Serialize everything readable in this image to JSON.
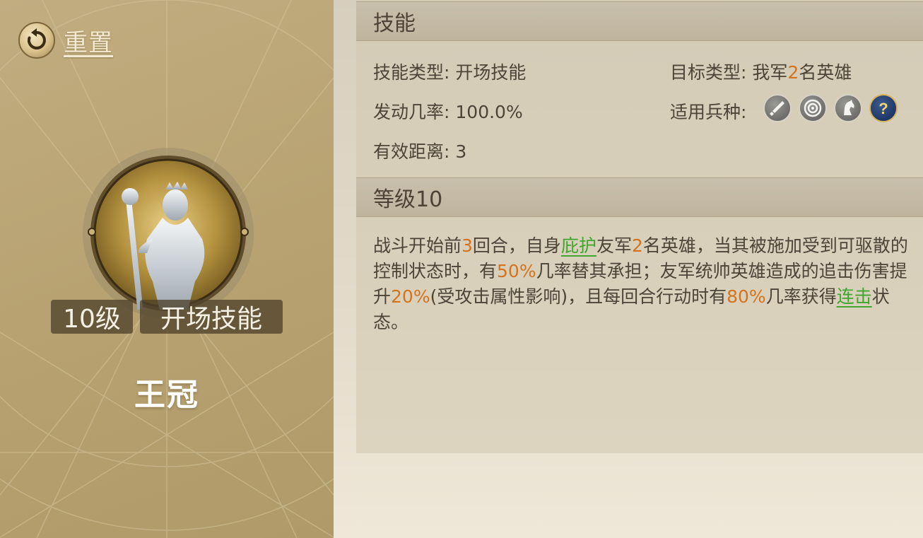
{
  "reset": {
    "label": "重置",
    "icon": "reset-arrow-icon"
  },
  "skill": {
    "name": "王冠",
    "level_tag": "10级",
    "type_tag": "开场技能",
    "portrait_icon": "crowned-queen-statue-icon"
  },
  "section_skill": {
    "title": "技能",
    "type_label": "技能类型:",
    "type_value": "开场技能",
    "target_label": "目标类型:",
    "target_prefix": "我军",
    "target_number": "2",
    "target_suffix": "名英雄",
    "rate_label": "发动几率:",
    "rate_value": "100.0%",
    "troops_label": "适用兵种:",
    "troops": [
      "sword-infantry-icon",
      "archer-target-icon",
      "cavalry-horse-icon",
      "unknown-question-icon"
    ],
    "range_label": "有效距离:",
    "range_value": "3"
  },
  "section_level": {
    "title": "等级10",
    "desc": {
      "p1": "战斗开始前",
      "n1": "3",
      "p2": "回合，自身",
      "link1": "庇护",
      "p3": "友军",
      "n2": "2",
      "p4": "名英雄，当其被施加受到可驱散的控制状态时，有",
      "n3": "50%",
      "p5": "几率替其承担；友军统帅英雄造成的追击伤害提升",
      "n4": "20%",
      "p6": "(受攻击属性影响)，且每回合行动时有",
      "n5": "80%",
      "p7": "几率获得",
      "link2": "连击",
      "p8": "状态。"
    }
  },
  "colors": {
    "highlight_orange": "#d4731e",
    "link_green": "#3fa52e",
    "panel_gold": "#b8a272"
  }
}
